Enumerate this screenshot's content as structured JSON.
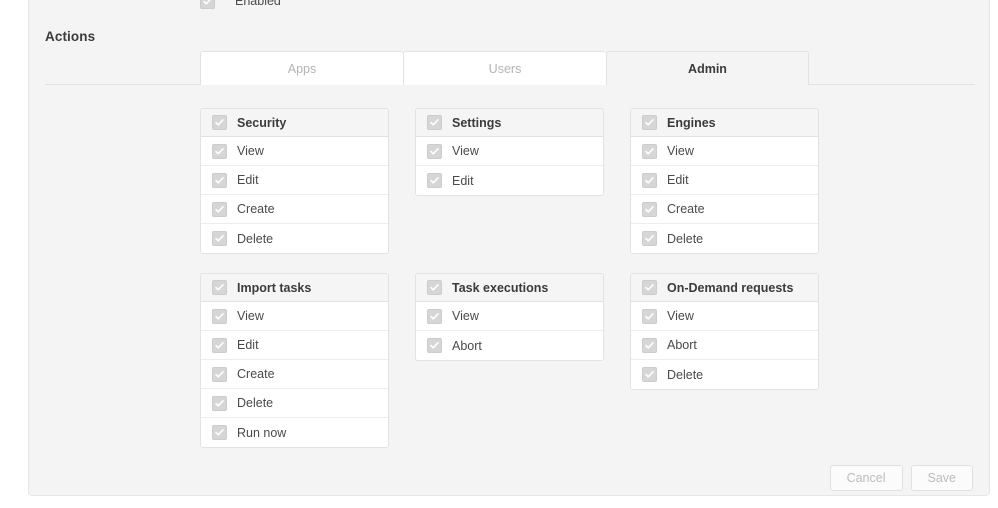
{
  "top_partial_row": {
    "label": "Enabled",
    "checkbox_icon": "checkbox-checked-disabled-icon"
  },
  "section": {
    "title": "Actions"
  },
  "tabs": [
    {
      "label": "Apps",
      "active": false
    },
    {
      "label": "Users",
      "active": false
    },
    {
      "label": "Admin",
      "active": true
    }
  ],
  "cards": [
    {
      "title": "Security",
      "items": [
        "View",
        "Edit",
        "Create",
        "Delete"
      ]
    },
    {
      "title": "Settings",
      "items": [
        "View",
        "Edit"
      ]
    },
    {
      "title": "Engines",
      "items": [
        "View",
        "Edit",
        "Create",
        "Delete"
      ]
    },
    {
      "title": "Import tasks",
      "items": [
        "View",
        "Edit",
        "Create",
        "Delete",
        "Run now"
      ]
    },
    {
      "title": "Task executions",
      "items": [
        "View",
        "Abort"
      ]
    },
    {
      "title": "On-Demand requests",
      "items": [
        "View",
        "Abort",
        "Delete"
      ]
    }
  ],
  "footer": {
    "cancel_label": "Cancel",
    "save_label": "Save"
  },
  "colors": {
    "panel_bg": "#f4f4f4",
    "card_bg": "#ffffff",
    "card_header_bg": "#f5f5f5",
    "border": "#e2e2e2",
    "text_primary": "#3b3b3b",
    "text_secondary": "#4a4a4a",
    "text_muted": "#b4b4b4",
    "checkbox_fill": "#d6d6d6",
    "checkmark": "#ffffff"
  }
}
